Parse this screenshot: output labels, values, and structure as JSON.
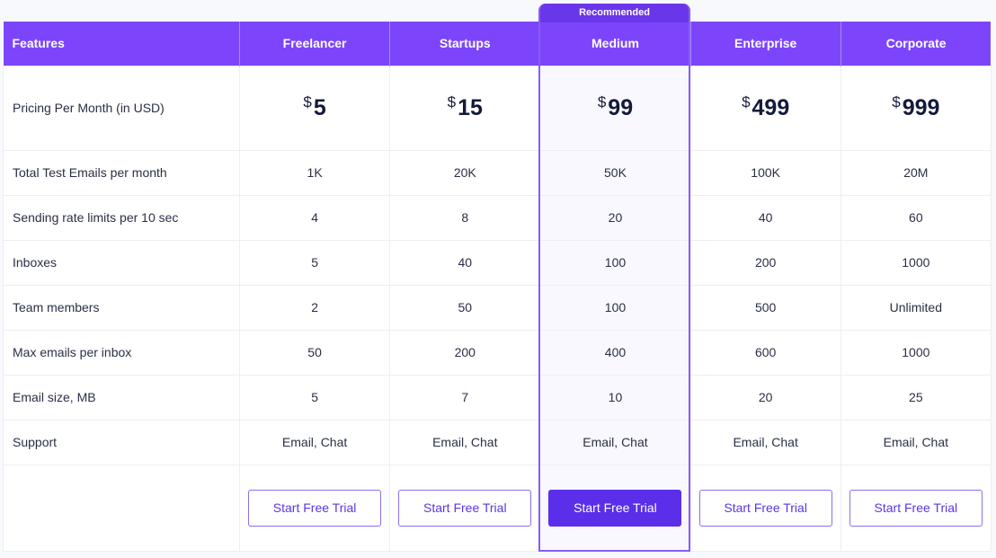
{
  "recommended_badge": "Recommended",
  "table": {
    "feature_header": "Features",
    "plans": [
      {
        "name": "Freelancer",
        "currency": "$",
        "price": "5",
        "recommended": false,
        "cta": "Start Free Trial"
      },
      {
        "name": "Startups",
        "currency": "$",
        "price": "15",
        "recommended": false,
        "cta": "Start Free Trial"
      },
      {
        "name": "Medium",
        "currency": "$",
        "price": "99",
        "recommended": true,
        "cta": "Start Free Trial"
      },
      {
        "name": "Enterprise",
        "currency": "$",
        "price": "499",
        "recommended": false,
        "cta": "Start Free Trial"
      },
      {
        "name": "Corporate",
        "currency": "$",
        "price": "999",
        "recommended": false,
        "cta": "Start Free Trial"
      }
    ],
    "pricing_label": "Pricing Per Month (in USD)",
    "rows": [
      {
        "label": "Total Test Emails per month",
        "values": [
          "1K",
          "20K",
          "50K",
          "100K",
          "20M"
        ]
      },
      {
        "label": "Sending rate limits per 10 sec",
        "values": [
          "4",
          "8",
          "20",
          "40",
          "60"
        ]
      },
      {
        "label": "Inboxes",
        "values": [
          "5",
          "40",
          "100",
          "200",
          "1000"
        ]
      },
      {
        "label": "Team members",
        "values": [
          "2",
          "50",
          "100",
          "500",
          "Unlimited"
        ]
      },
      {
        "label": "Max emails per inbox",
        "values": [
          "50",
          "200",
          "400",
          "600",
          "1000"
        ]
      },
      {
        "label": "Email size, MB",
        "values": [
          "5",
          "7",
          "10",
          "20",
          "25"
        ]
      },
      {
        "label": "Support",
        "values": [
          "Email, Chat",
          "Email, Chat",
          "Email, Chat",
          "Email, Chat",
          "Email, Chat"
        ]
      }
    ]
  },
  "colors": {
    "header_bg": "#7c45fb",
    "accent": "#5b2eea",
    "recommended_outline": "#8a5cf6",
    "recommended_bg": "#f9f8fe"
  }
}
